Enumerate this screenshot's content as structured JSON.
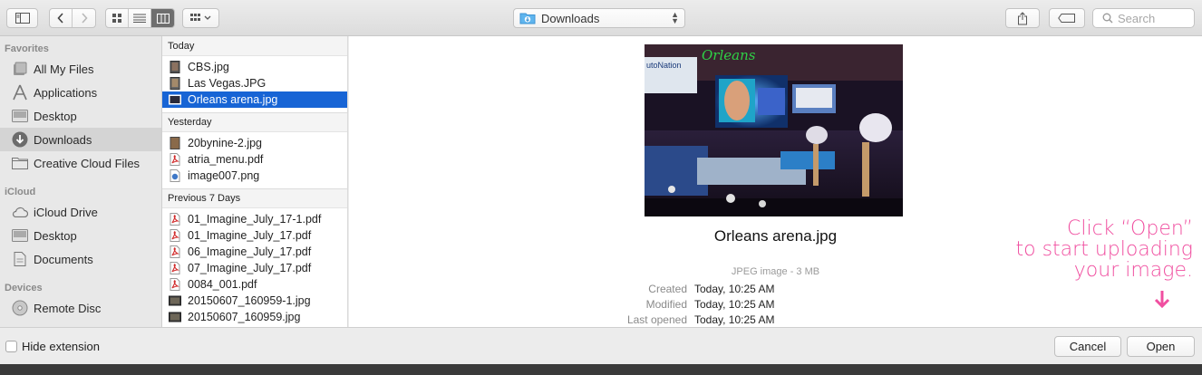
{
  "toolbar": {
    "location": "Downloads",
    "search_placeholder": "Search"
  },
  "sidebar": {
    "sections": [
      {
        "title": "Favorites",
        "items": [
          {
            "label": "All My Files",
            "icon": "all-files-icon"
          },
          {
            "label": "Applications",
            "icon": "applications-icon"
          },
          {
            "label": "Desktop",
            "icon": "desktop-icon"
          },
          {
            "label": "Downloads",
            "icon": "downloads-icon",
            "selected": true
          },
          {
            "label": "Creative Cloud Files",
            "icon": "folder-icon"
          }
        ]
      },
      {
        "title": "iCloud",
        "items": [
          {
            "label": "iCloud Drive",
            "icon": "cloud-icon"
          },
          {
            "label": "Desktop",
            "icon": "desktop-icon"
          },
          {
            "label": "Documents",
            "icon": "document-icon"
          }
        ]
      },
      {
        "title": "Devices",
        "items": [
          {
            "label": "Remote Disc",
            "icon": "disc-icon"
          }
        ]
      }
    ]
  },
  "filelist": {
    "groups": [
      {
        "title": "Today",
        "files": [
          {
            "name": "CBS.jpg",
            "type": "image"
          },
          {
            "name": "Las Vegas.JPG",
            "type": "image"
          },
          {
            "name": "Orleans arena.jpg",
            "type": "image",
            "selected": true
          }
        ]
      },
      {
        "title": "Yesterday",
        "files": [
          {
            "name": "20bynine-2.jpg",
            "type": "image"
          },
          {
            "name": "atria_menu.pdf",
            "type": "pdf"
          },
          {
            "name": "image007.png",
            "type": "png"
          }
        ]
      },
      {
        "title": "Previous 7 Days",
        "files": [
          {
            "name": "01_Imagine_July_17-1.pdf",
            "type": "pdf"
          },
          {
            "name": "01_Imagine_July_17.pdf",
            "type": "pdf"
          },
          {
            "name": "06_Imagine_July_17.pdf",
            "type": "pdf"
          },
          {
            "name": "07_Imagine_July_17.pdf",
            "type": "pdf"
          },
          {
            "name": "0084_001.pdf",
            "type": "pdf"
          },
          {
            "name": "20150607_160959-1.jpg",
            "type": "image"
          },
          {
            "name": "20150607_160959.jpg",
            "type": "image"
          }
        ]
      }
    ]
  },
  "preview": {
    "filename": "Orleans arena.jpg",
    "kind": "JPEG image - 3 MB",
    "meta": [
      {
        "label": "Created",
        "value": "Today, 10:25 AM"
      },
      {
        "label": "Modified",
        "value": "Today, 10:25 AM"
      },
      {
        "label": "Last opened",
        "value": "Today, 10:25 AM"
      }
    ],
    "photo_sign_text": "Orleans",
    "photo_sign_left": "utoNation",
    "annotation": [
      "Click “Open”",
      "to start uploading",
      "your image."
    ]
  },
  "bottom": {
    "hide_extension": "Hide extension",
    "cancel": "Cancel",
    "open": "Open"
  },
  "colors": {
    "selection": "#1764d5",
    "annotation": "#f04fa0"
  }
}
